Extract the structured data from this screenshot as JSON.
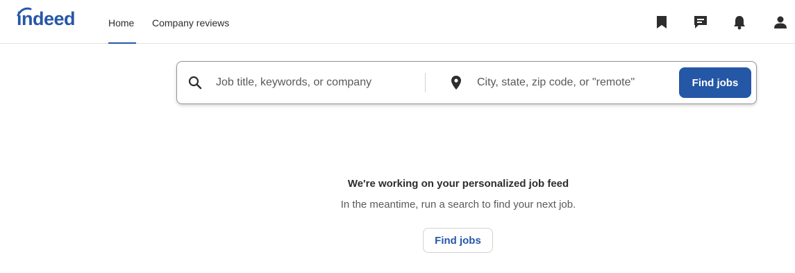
{
  "brand": {
    "logo_text": "indeed",
    "accent_color": "#2557a7"
  },
  "nav": {
    "items": [
      {
        "label": "Home",
        "active": true
      },
      {
        "label": "Company reviews",
        "active": false
      }
    ]
  },
  "header_icons": [
    "bookmark-icon",
    "messages-icon",
    "notifications-icon",
    "profile-icon"
  ],
  "search": {
    "what_placeholder": "Job title, keywords, or company",
    "what_value": "",
    "where_placeholder": "City, state, zip code, or \"remote\"",
    "where_value": "",
    "submit_label": "Find jobs"
  },
  "feed": {
    "title": "We're working on your personalized job feed",
    "subtitle": "In the meantime, run a search to find your next job.",
    "cta_label": "Find jobs"
  }
}
